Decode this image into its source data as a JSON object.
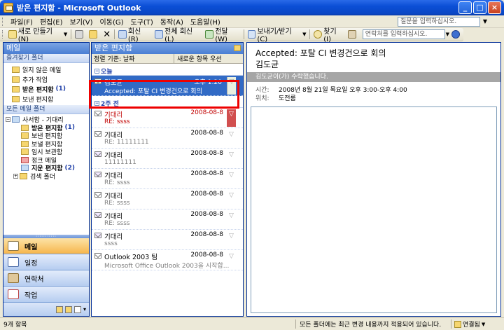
{
  "window": {
    "title": "받은 편지함 - Microsoft Outlook"
  },
  "menu": {
    "items": [
      "파일(F)",
      "편집(E)",
      "보기(V)",
      "이동(G)",
      "도구(T)",
      "동작(A)",
      "도움말(H)"
    ],
    "help_placeholder": "질문을 입력하십시오."
  },
  "toolbar": {
    "new_label": "새로 만들기(N)",
    "reply_label": "회신(R)",
    "reply_all_label": "전체 회신(L)",
    "forward_label": "전달(W)",
    "send_receive_label": "보내기/받기(C)",
    "find_label": "찾기(I)",
    "contact_placeholder": "연락처를 입력하십시오."
  },
  "nav": {
    "header": "메일",
    "favorites_title": "즐겨찾기 폴더",
    "favorites": [
      {
        "label": "읽지 않은 메일",
        "count": ""
      },
      {
        "label": "추가 작업",
        "count": ""
      },
      {
        "label": "받은 편지함",
        "count": "(1)"
      },
      {
        "label": "보낸 편지함",
        "count": ""
      }
    ],
    "all_folders_title": "모든 메일 폴더",
    "mailbox": "사서함 - 기대리",
    "folders": [
      {
        "label": "받은 편지함",
        "count": "(1)"
      },
      {
        "label": "보낸 편지함",
        "count": ""
      },
      {
        "label": "보낼 편지함",
        "count": ""
      },
      {
        "label": "임시 보관함",
        "count": ""
      },
      {
        "label": "정크 메일",
        "count": ""
      },
      {
        "label": "지운 편지함",
        "count": "(2)"
      },
      {
        "label": "검색 폴더",
        "count": ""
      }
    ],
    "buttons": [
      "메일",
      "일정",
      "연락처",
      "작업"
    ]
  },
  "list": {
    "header": "받은 편지함",
    "sort_label": "정렬 기준: 날짜",
    "sort_order": "새로운 항목 우선",
    "group_today": "오늘",
    "group_two_weeks": "2주 전",
    "selected": {
      "sender": "김도균",
      "time": "오후 1:20",
      "subject": "Accepted: 포탈 CI 변경건으로 회의"
    },
    "messages": [
      {
        "sender": "기대리",
        "date": "2008-08-8",
        "subject": "RE: ssss"
      },
      {
        "sender": "기대리",
        "date": "2008-08-8",
        "subject": "RE: 11111111"
      },
      {
        "sender": "기대리",
        "date": "2008-08-8",
        "subject": "11111111"
      },
      {
        "sender": "기대리",
        "date": "2008-08-8",
        "subject": "RE: ssss"
      },
      {
        "sender": "기대리",
        "date": "2008-08-8",
        "subject": "RE: ssss"
      },
      {
        "sender": "기대리",
        "date": "2008-08-8",
        "subject": "RE: ssss"
      },
      {
        "sender": "기대리",
        "date": "2008-08-8",
        "subject": "ssss"
      },
      {
        "sender": "Outlook 2003 팀",
        "date": "2008-08-8",
        "subject": "Microsoft Office Outlook 2003을 시작합..."
      }
    ]
  },
  "reading": {
    "title": "Accepted: 포탈 CI 변경건으로 회의",
    "from": "김도균",
    "banner": "김도균이(가) 수락했습니다.",
    "time_label": "시간:",
    "time_value": "2008년 8월 21일 목요일 오후 3:00-오후 4:00",
    "place_label": "위치:",
    "place_value": "도전룸"
  },
  "status": {
    "count": "9개 항목",
    "center": "모든 폴더에는 최근 변경 내용까지 적용되어 있습니다.",
    "connection": "연결됨"
  },
  "colors": {
    "accent_blue": "#316ac5",
    "unread_red": "#c00000",
    "highlight_outline": "#e00000"
  }
}
